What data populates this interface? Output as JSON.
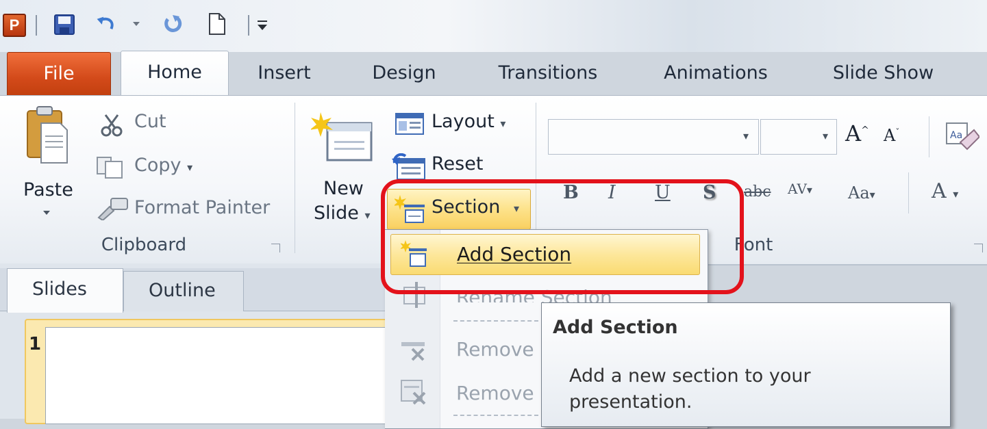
{
  "quick_access": {
    "app_letter": "P",
    "icons": [
      "save-icon",
      "undo-icon",
      "redo-icon",
      "new-document-icon",
      "customize-qat-icon"
    ]
  },
  "tabs": {
    "file": "File",
    "home": "Home",
    "insert": "Insert",
    "design": "Design",
    "transitions": "Transitions",
    "animations": "Animations",
    "slide_show": "Slide Show"
  },
  "clipboard": {
    "paste": "Paste",
    "cut": "Cut",
    "copy": "Copy",
    "format_painter": "Format Painter",
    "group_label": "Clipboard"
  },
  "slides": {
    "new_slide_line1": "New",
    "new_slide_line2": "Slide",
    "layout": "Layout",
    "reset": "Reset",
    "section": "Section"
  },
  "font": {
    "group_label": "Font",
    "bold": "B",
    "italic": "I",
    "underline": "U",
    "shadow": "S",
    "strike": "abc",
    "spacing": "AV",
    "case": "Aa",
    "color": "A"
  },
  "section_menu": {
    "add_section": "Add Section",
    "rename_section": "Rename Section",
    "remove_1": "Remove",
    "remove_2": "Remove"
  },
  "tooltip": {
    "title": "Add Section",
    "description": "Add a new section to your presentation."
  },
  "pane": {
    "tab_slides": "Slides",
    "tab_outline": "Outline",
    "slide_number": "1"
  },
  "colors": {
    "file_tab": "#d34a1a",
    "highlight": "#fde28a",
    "annotation_red": "#e3121b"
  }
}
